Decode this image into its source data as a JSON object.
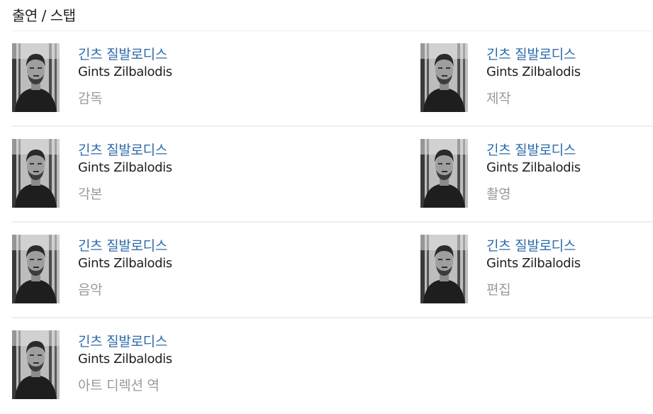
{
  "section": {
    "title": "출연 / 스탭"
  },
  "people": [
    {
      "name_ko": "긴츠 질발로디스",
      "name_en": "Gints Zilbalodis",
      "role": "감독",
      "photo_icon": "person-portrait-icon"
    },
    {
      "name_ko": "긴츠 질발로디스",
      "name_en": "Gints Zilbalodis",
      "role": "제작",
      "photo_icon": "person-portrait-icon"
    },
    {
      "name_ko": "긴츠 질발로디스",
      "name_en": "Gints Zilbalodis",
      "role": "각본",
      "photo_icon": "person-portrait-icon"
    },
    {
      "name_ko": "긴츠 질발로디스",
      "name_en": "Gints Zilbalodis",
      "role": "촬영",
      "photo_icon": "person-portrait-icon"
    },
    {
      "name_ko": "긴츠 질발로디스",
      "name_en": "Gints Zilbalodis",
      "role": "음악",
      "photo_icon": "person-portrait-icon"
    },
    {
      "name_ko": "긴츠 질발로디스",
      "name_en": "Gints Zilbalodis",
      "role": "편집",
      "photo_icon": "person-portrait-icon"
    },
    {
      "name_ko": "긴츠 질발로디스",
      "name_en": "Gints Zilbalodis",
      "role": "아트 디렉션 역",
      "photo_icon": "person-portrait-icon"
    }
  ],
  "colors": {
    "name_link": "#2b6aa8",
    "role_text": "#9a9a9a",
    "divider": "#eeeeee"
  }
}
